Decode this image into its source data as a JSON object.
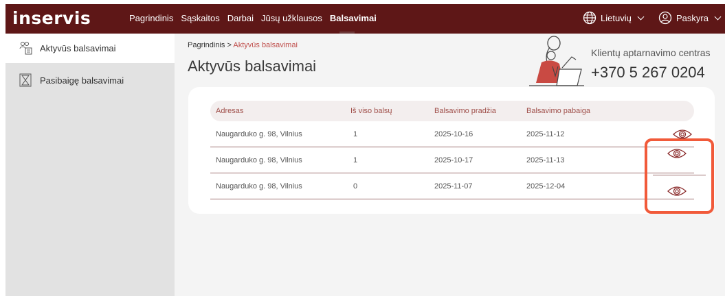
{
  "brand": {
    "logo": "inservis"
  },
  "nav": {
    "items": [
      "Pagrindinis",
      "Sąskaitos",
      "Darbai",
      "Jūsų užklausos",
      "Balsavimai"
    ],
    "active_index": 4
  },
  "language": {
    "label": "Lietuvių",
    "icon": "globe-icon"
  },
  "account": {
    "label": "Paskyra",
    "icon": "user-icon"
  },
  "sidebar": {
    "items": [
      {
        "label": "Aktyvūs balsavimai",
        "icon": "active-votes-icon",
        "active": true
      },
      {
        "label": "Pasibaigę balsavimai",
        "icon": "hourglass-icon",
        "active": false
      }
    ]
  },
  "breadcrumb": {
    "home": "Pagrindinis",
    "separator": ">",
    "current": "Aktyvūs balsavimai"
  },
  "page_title": "Aktyvūs balsavimai",
  "support": {
    "label": "Klientų aptarnavimo centras",
    "phone": "+370 5 267 0204"
  },
  "table": {
    "columns": [
      "Adresas",
      "Iš viso balsų",
      "Balsavimo pradžia",
      "Balsavimo pabaiga"
    ],
    "rows": [
      {
        "address": "Naugarduko g. 98, Vilnius",
        "total": "1",
        "start": "2025-10-16",
        "end": "2025-11-12"
      },
      {
        "address": "Naugarduko g. 98, Vilnius",
        "total": "1",
        "start": "2025-10-17",
        "end": "2025-11-13"
      },
      {
        "address": "Naugarduko g. 98, Vilnius",
        "total": "0",
        "start": "2025-11-07",
        "end": "2025-12-04"
      }
    ],
    "action_icon": "eye-icon"
  },
  "colors": {
    "topbar": "#5e1717",
    "accent": "#c0504d",
    "highlight": "#f15a3a"
  }
}
